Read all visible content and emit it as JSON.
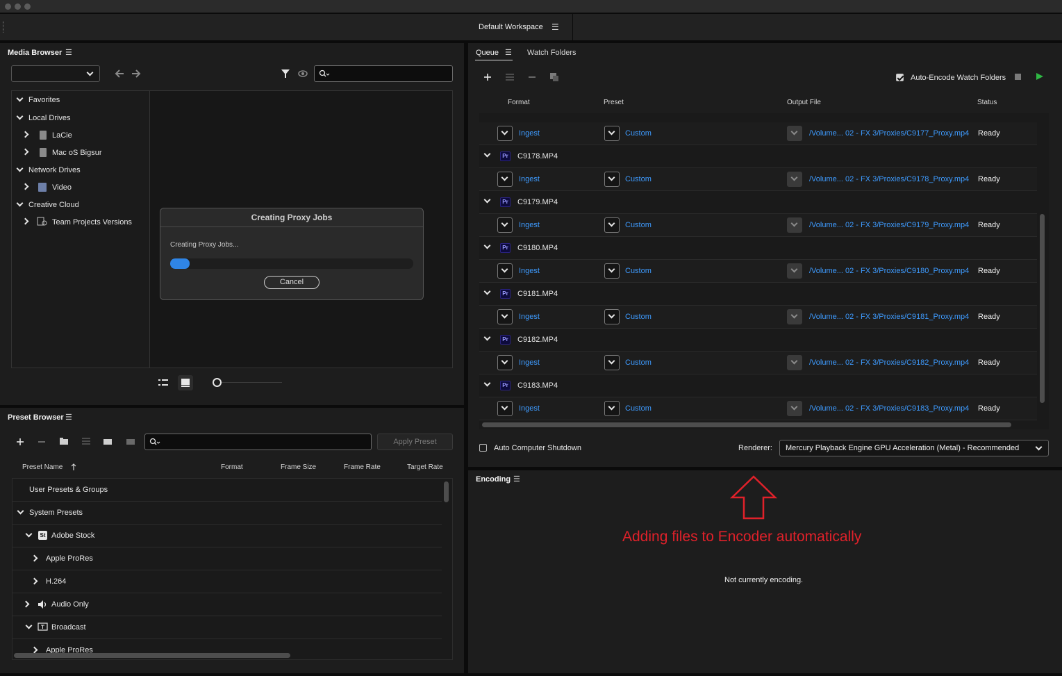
{
  "workspace": {
    "title": "Default Workspace",
    "menu_glyph": "☰"
  },
  "media_browser": {
    "title": "Media Browser",
    "tree": [
      {
        "label": "Favorites",
        "level": 0,
        "expanded": true
      },
      {
        "label": "Local Drives",
        "level": 0,
        "expanded": true
      },
      {
        "label": "LaCie",
        "level": 1,
        "expanded": false
      },
      {
        "label": "Mac oS Bigsur",
        "level": 1,
        "expanded": false
      },
      {
        "label": "Network Drives",
        "level": 0,
        "expanded": true
      },
      {
        "label": "Video",
        "level": 1,
        "expanded": false
      },
      {
        "label": "Creative Cloud",
        "level": 0,
        "expanded": true
      },
      {
        "label": "Team Projects Versions",
        "level": 1,
        "expanded": false
      }
    ]
  },
  "dialog": {
    "title": "Creating Proxy Jobs",
    "message": "Creating Proxy Jobs...",
    "progress": 0.08,
    "cancel_label": "Cancel"
  },
  "preset_browser": {
    "title": "Preset Browser",
    "apply_label": "Apply Preset",
    "columns": [
      "Preset Name",
      "Format",
      "Frame Size",
      "Frame Rate",
      "Target Rate"
    ],
    "rows": [
      {
        "label": "User Presets & Groups",
        "level": 0,
        "chevron": "none"
      },
      {
        "label": "System Presets",
        "level": 0,
        "chevron": "down"
      },
      {
        "label": "Adobe Stock",
        "level": 1,
        "chevron": "down",
        "icon": "St"
      },
      {
        "label": "Apple ProRes",
        "level": 2,
        "chevron": "right"
      },
      {
        "label": "H.264",
        "level": 2,
        "chevron": "right"
      },
      {
        "label": "Audio Only",
        "level": 1,
        "chevron": "right",
        "icon": "speaker"
      },
      {
        "label": "Broadcast",
        "level": 1,
        "chevron": "down",
        "icon": "tv"
      },
      {
        "label": "Apple ProRes",
        "level": 2,
        "chevron": "right"
      }
    ]
  },
  "queue": {
    "tab_queue": "Queue",
    "tab_watch": "Watch Folders",
    "auto_encode_label": "Auto-Encode Watch Folders",
    "auto_encode_checked": true,
    "columns": {
      "format": "Format",
      "preset": "Preset",
      "output": "Output File",
      "status": "Status"
    },
    "first_sub": {
      "format": "Ingest",
      "preset": "Custom",
      "output": "/Volume... 02 - FX 3/Proxies/C9177_Proxy.mp4",
      "status": "Ready"
    },
    "jobs": [
      {
        "name": "C9178.MP4",
        "format": "Ingest",
        "preset": "Custom",
        "output": "/Volume... 02 - FX 3/Proxies/C9178_Proxy.mp4",
        "status": "Ready"
      },
      {
        "name": "C9179.MP4",
        "format": "Ingest",
        "preset": "Custom",
        "output": "/Volume... 02 - FX 3/Proxies/C9179_Proxy.mp4",
        "status": "Ready"
      },
      {
        "name": "C9180.MP4",
        "format": "Ingest",
        "preset": "Custom",
        "output": "/Volume... 02 - FX 3/Proxies/C9180_Proxy.mp4",
        "status": "Ready"
      },
      {
        "name": "C9181.MP4",
        "format": "Ingest",
        "preset": "Custom",
        "output": "/Volume... 02 - FX 3/Proxies/C9181_Proxy.mp4",
        "status": "Ready"
      },
      {
        "name": "C9182.MP4",
        "format": "Ingest",
        "preset": "Custom",
        "output": "/Volume... 02 - FX 3/Proxies/C9182_Proxy.mp4",
        "status": "Ready"
      },
      {
        "name": "C9183.MP4",
        "format": "Ingest",
        "preset": "Custom",
        "output": "/Volume... 02 - FX 3/Proxies/C9183_Proxy.mp4",
        "status": "Ready"
      }
    ],
    "badge": "Pr",
    "auto_shutdown_label": "Auto Computer Shutdown",
    "renderer_label": "Renderer:",
    "renderer_value": "Mercury Playback Engine GPU Acceleration (Metal) - Recommended"
  },
  "encoding": {
    "title": "Encoding",
    "annotation": "Adding files to Encoder automatically",
    "status": "Not currently encoding."
  },
  "colors": {
    "accent": "#2f85e6",
    "link": "#3e9bff",
    "annotation": "#e0212a",
    "play": "#2fb844"
  }
}
